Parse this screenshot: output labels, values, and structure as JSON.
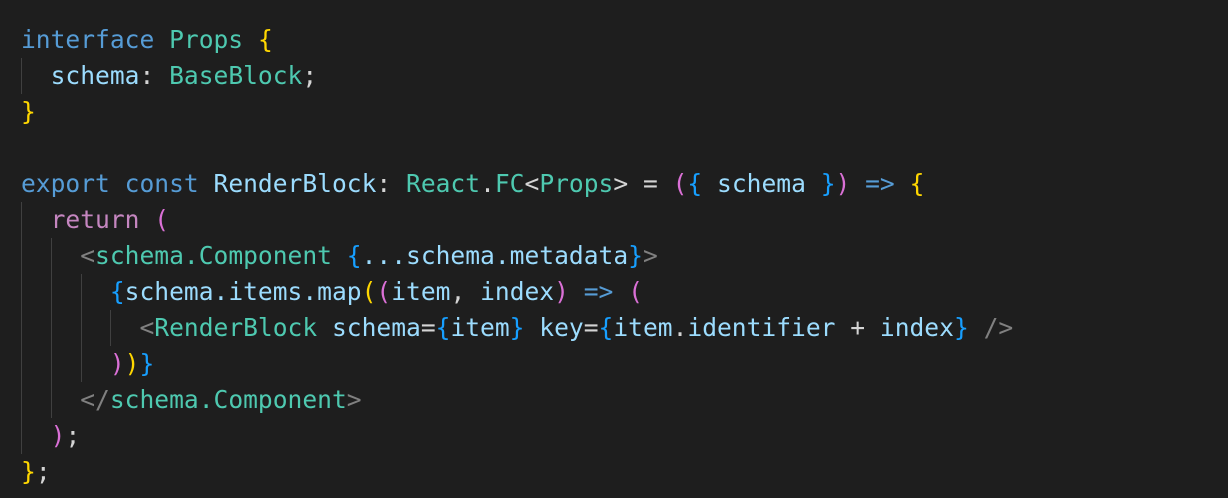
{
  "code": {
    "lines": [
      {
        "tokens": [
          "interface",
          " ",
          "Props",
          " ",
          "{"
        ]
      },
      {
        "tokens": [
          "  ",
          "schema",
          ": ",
          "BaseBlock",
          ";"
        ]
      },
      {
        "tokens": [
          "}"
        ]
      },
      {
        "tokens": [
          ""
        ]
      },
      {
        "tokens": [
          "export",
          " ",
          "const",
          " ",
          "RenderBlock",
          ": ",
          "React",
          ".",
          "FC",
          "<",
          "Props",
          ">",
          " = ",
          "(",
          "{",
          " ",
          "schema",
          " ",
          "}",
          ")",
          " ",
          "=>",
          " ",
          "{"
        ]
      },
      {
        "tokens": [
          "  ",
          "return",
          " ",
          "("
        ]
      },
      {
        "tokens": [
          "    ",
          "<",
          "schema",
          ".",
          "Component",
          " ",
          "{",
          "...",
          "schema",
          ".",
          "metadata",
          "}",
          ">"
        ]
      },
      {
        "tokens": [
          "      ",
          "{",
          "schema",
          ".",
          "items",
          ".",
          "map",
          "(",
          "(",
          "item",
          ", ",
          "index",
          ")",
          " ",
          "=>",
          " ",
          "("
        ]
      },
      {
        "tokens": [
          "        ",
          "<",
          "RenderBlock",
          " ",
          "schema",
          "=",
          "{",
          "item",
          "}",
          " ",
          "key",
          "=",
          "{",
          "item",
          ".",
          "identifier",
          " + ",
          "index",
          "}",
          " ",
          "/>"
        ]
      },
      {
        "tokens": [
          "      ",
          ")",
          ")",
          "}"
        ]
      },
      {
        "tokens": [
          "    ",
          "</",
          "schema",
          ".",
          "Component",
          ">"
        ]
      },
      {
        "tokens": [
          "  ",
          ")",
          ";"
        ]
      },
      {
        "tokens": [
          "}",
          ";"
        ]
      }
    ]
  }
}
